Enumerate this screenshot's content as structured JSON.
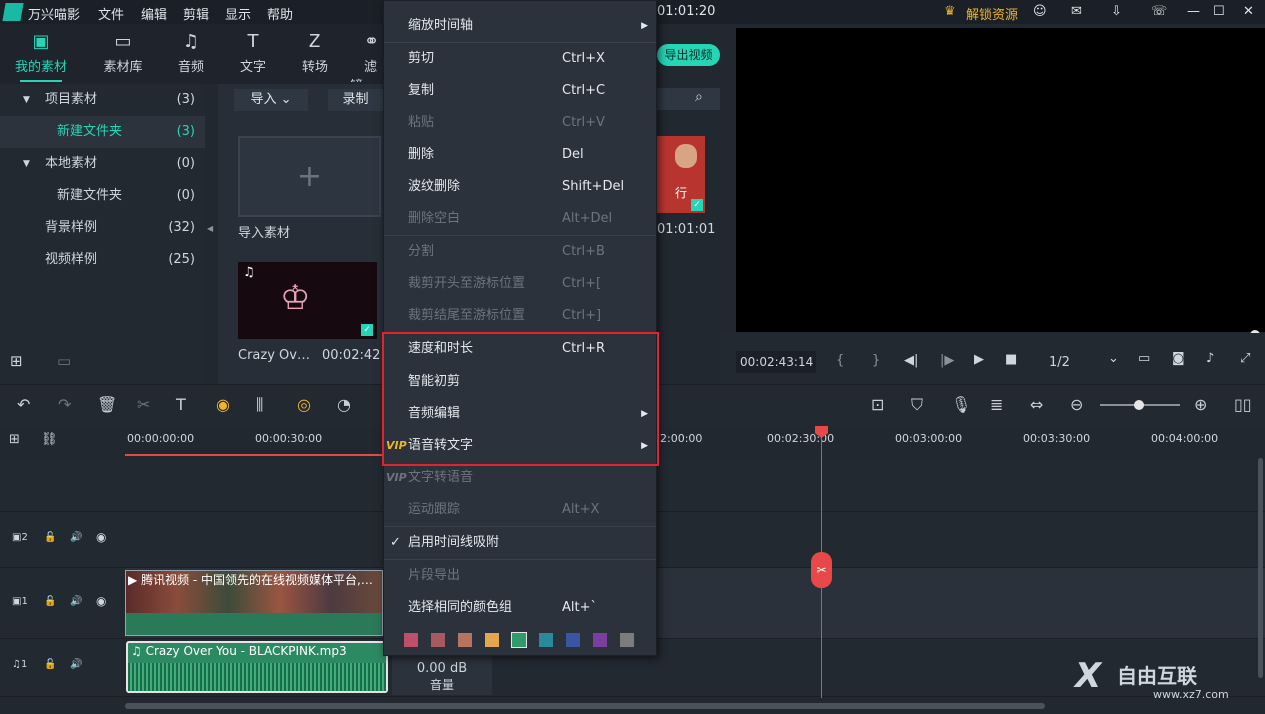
{
  "menubar": {
    "app_name": "万兴喵影",
    "items": [
      "文件",
      "编辑",
      "剪辑",
      "显示",
      "帮助"
    ],
    "timecode": "01:01:20",
    "unlock": "解锁资源"
  },
  "media_tabs": [
    "我的素材",
    "素材库",
    "音频",
    "文字",
    "转场",
    "滤镜"
  ],
  "tree": [
    {
      "label": "项目素材",
      "count": "(3)"
    },
    {
      "label": "新建文件夹",
      "count": "(3)"
    },
    {
      "label": "本地素材",
      "count": "(0)"
    },
    {
      "label": "新建文件夹",
      "count": "(0)"
    },
    {
      "label": "背景样例",
      "count": "(32)"
    },
    {
      "label": "视频样例",
      "count": "(25)"
    }
  ],
  "media": {
    "import_btn": "导入",
    "record_btn": "录制",
    "import_tile_label": "导入素材",
    "clip_name": "Crazy Ov…",
    "clip_duration": "00:02:42",
    "video_duration": "01:01:01",
    "video_text": "行",
    "export_btn": "导出视频"
  },
  "preview": {
    "time": "00:02:43:14",
    "page": "1/2"
  },
  "ruler": [
    "00:00:00:00",
    "00:00:30:00",
    "2:00:00",
    "00:02:30:00",
    "00:03:00:00",
    "00:03:30:00",
    "00:04:00:00"
  ],
  "tracks": {
    "video_clip_title": "腾讯视频 - 中国领先的在线视频媒体平台,…",
    "audio_clip_title": "Crazy Over You - BLACKPINK.mp3",
    "db_value": "0.00 dB",
    "db_label": "音量",
    "t2": "2",
    "t1": "1",
    "a1": "1"
  },
  "context_menu": {
    "items": [
      {
        "label": "缩放时间轴",
        "shortcut": ""
      },
      {
        "label": "剪切",
        "shortcut": "Ctrl+X"
      },
      {
        "label": "复制",
        "shortcut": "Ctrl+C"
      },
      {
        "label": "粘贴",
        "shortcut": "Ctrl+V"
      },
      {
        "label": "删除",
        "shortcut": "Del"
      },
      {
        "label": "波纹删除",
        "shortcut": "Shift+Del"
      },
      {
        "label": "删除空白",
        "shortcut": "Alt+Del"
      },
      {
        "label": "分割",
        "shortcut": "Ctrl+B"
      },
      {
        "label": "裁剪开头至游标位置",
        "shortcut": "Ctrl+["
      },
      {
        "label": "裁剪结尾至游标位置",
        "shortcut": "Ctrl+]"
      },
      {
        "label": "速度和时长",
        "shortcut": "Ctrl+R"
      },
      {
        "label": "智能初剪",
        "shortcut": ""
      },
      {
        "label": "音频编辑",
        "shortcut": ""
      },
      {
        "label": "语音转文字",
        "shortcut": ""
      },
      {
        "label": "文字转语音",
        "shortcut": ""
      },
      {
        "label": "运动跟踪",
        "shortcut": "Alt+X"
      },
      {
        "label": "启用时间线吸附",
        "shortcut": ""
      },
      {
        "label": "片段导出",
        "shortcut": ""
      },
      {
        "label": "选择相同的颜色组",
        "shortcut": "Alt+`"
      }
    ],
    "vip_badge": "VIP",
    "swatches": [
      "#c0506a",
      "#a65a5f",
      "#b8735f",
      "#e3a64d",
      "#2f9a6a",
      "#2a8a9c",
      "#3b56a0",
      "#7b3fa0",
      "#7c7c7c"
    ]
  },
  "watermark": {
    "text": "自由互联",
    "url": "www.xz7.com"
  },
  "colors": {
    "accent": "#25d5b6",
    "highlight": "#e3232b",
    "playhead": "#e84848"
  }
}
